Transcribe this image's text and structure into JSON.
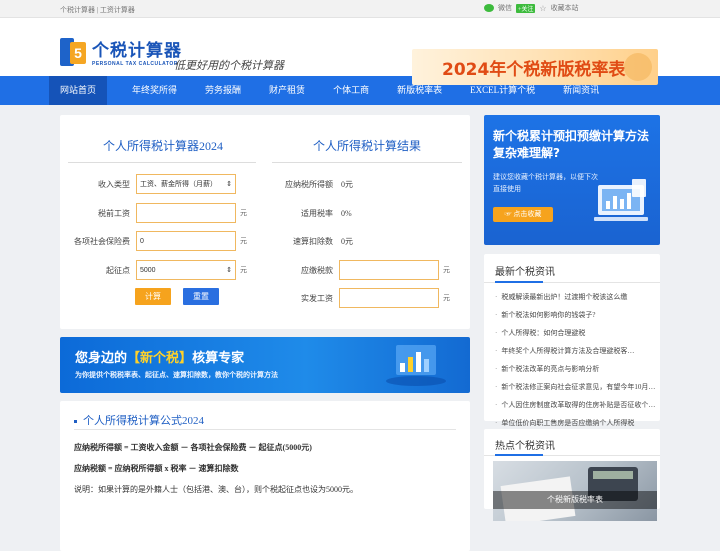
{
  "topbar": {
    "left": "个税计算器 | 工资计算器",
    "wechat": "微信",
    "follow": "+关注",
    "favorite": "收藏本站"
  },
  "header": {
    "logo_cn": "个税计算器",
    "logo_en": "PERSONAL TAX CALCULATOR",
    "slogan": "低更好用的个税计算器",
    "banner": "2024年个税新版税率表"
  },
  "nav": [
    "网站首页",
    "年终奖所得",
    "劳务报酬",
    "财产租赁",
    "个体工商",
    "新版税率表",
    "EXCEL计算个税",
    "新闻资讯"
  ],
  "calc": {
    "title_left": "个人所得税计算器2024",
    "title_right": "个人所得税计算结果",
    "income_type_label": "收入类型",
    "income_type_value": "工资、薪金所得（月薪）",
    "salary_label": "税前工资",
    "salary_value": "",
    "salary_unit": "元",
    "insurance_label": "各项社会保险费",
    "insurance_value": "0",
    "insurance_unit": "元",
    "threshold_label": "起征点",
    "threshold_value": "5000",
    "threshold_unit": "元",
    "calc_btn": "计算",
    "reset_btn": "重置",
    "taxable_label": "应纳税所得额",
    "taxable_value": "0元",
    "rate_label": "适用税率",
    "rate_value": "0%",
    "deduction_label": "速算扣除数",
    "deduction_value": "0元",
    "tax_label": "应缴税款",
    "tax_value": "",
    "tax_unit": "元",
    "net_label": "实发工资",
    "net_value": "",
    "net_unit": "元"
  },
  "promo": {
    "pre": "您身边的",
    "bracket_l": "【",
    "highlight": "新个税",
    "bracket_r": "】",
    "post": "核算专家",
    "sub": "为你提供个税税率表、起征点、速算扣除数，教你个税的计算方法"
  },
  "formula": {
    "title": "个人所得税计算公式2024",
    "f1": "应纳税所得额 = 工资收入金额 － 各项社会保险费 － 起征点(5000元)",
    "f2": "应纳税额 = 应纳税所得额 x 税率 － 速算扣除数",
    "note": "说明：如果计算的是外籍人士（包括港、澳、台），则个税起征点也设为5000元。"
  },
  "ad": {
    "title": "新个税累计预扣预缴计算方法复杂难理解?",
    "sub": "建议您收藏个税计算器，以便下次直接使用",
    "btn": "点击收藏"
  },
  "news": {
    "title": "最新个税资讯",
    "items": [
      "税威解读最新出炉！过渡期个税该这么缴",
      "新个税法如何影响你的钱袋子?",
      "个人所得税：如何合理避税",
      "年终奖个人所得税计算方法及合理避税客…",
      "新个税法改革的亮点与影响分析",
      "新个税法修正案向社会征求意见，有望今年10月…",
      "个人因住房制度改革取得的住房补贴是否征收个…",
      "单位低价向职工售房是否应缴纳个人所得税"
    ]
  },
  "hot": {
    "title": "热点个税资讯",
    "caption": "个税新版税率表"
  }
}
